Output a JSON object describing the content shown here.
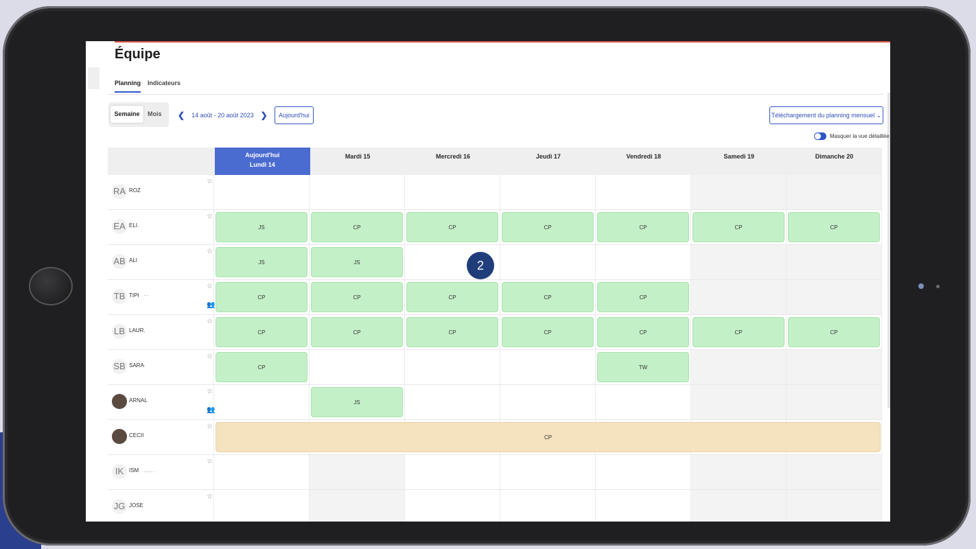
{
  "page": {
    "title": "Équipe",
    "tabs": [
      {
        "label": "Planning"
      },
      {
        "label": "Indicateurs"
      }
    ]
  },
  "toolbar": {
    "view_week": "Semaine",
    "view_month": "Mois",
    "prev_arrow": "❮",
    "date_range": "14 août - 20 août 2023",
    "next_arrow": "❯",
    "today_button": "Aujourd'hui",
    "download_button": "Téléchargement du planning mensuel ⌄",
    "toggle_label": "Masquer la vue détaillée"
  },
  "header": {
    "today_line1": "Aujourd'hui",
    "today_line2": "Lundi 14",
    "days": [
      "Mardi 15",
      "Mercredi 16",
      "Jeudi 17",
      "Vendredi 18",
      "Samedi 19",
      "Dimanche 20"
    ]
  },
  "rows": [
    {
      "initials": "RA",
      "name": "ROZ",
      "extra": "",
      "photo": false,
      "group": false,
      "cells": [
        "",
        "",
        "",
        "",
        "",
        "",
        ""
      ]
    },
    {
      "initials": "EA",
      "name": "ELI.",
      "extra": "",
      "photo": false,
      "group": false,
      "cells": [
        "JS",
        "CP",
        "CP",
        "CP",
        "CP",
        "CP",
        "CP"
      ]
    },
    {
      "initials": "AB",
      "name": "ALI",
      "extra": "",
      "photo": false,
      "group": false,
      "cells": [
        "JS",
        "JS",
        "",
        "",
        "",
        "",
        ""
      ]
    },
    {
      "initials": "TB",
      "name": "TIPł",
      "extra": "···",
      "photo": false,
      "group": true,
      "cells": [
        "CP",
        "CP",
        "CP",
        "CP",
        "CP",
        "",
        ""
      ]
    },
    {
      "initials": "LB",
      "name": "LAUR.",
      "extra": "",
      "photo": false,
      "group": false,
      "cells": [
        "CP",
        "CP",
        "CP",
        "CP",
        "CP",
        "CP",
        "CP"
      ]
    },
    {
      "initials": "SB",
      "name": "SARA",
      "extra": "·",
      "photo": false,
      "group": false,
      "cells": [
        "CP",
        "",
        "",
        "",
        "TW",
        "",
        ""
      ]
    },
    {
      "initials": "",
      "name": "ARNAL",
      "extra": "",
      "photo": true,
      "group": true,
      "cells": [
        "",
        "JS",
        "",
        "",
        "",
        "",
        ""
      ]
    },
    {
      "initials": "",
      "name": "CECII",
      "extra": "",
      "photo": true,
      "group": false,
      "wide": "CP",
      "cells": []
    },
    {
      "initials": "IK",
      "name": "ISM",
      "extra": "...... .",
      "photo": false,
      "group": false,
      "cells": [
        "",
        "",
        "",
        "",
        "",
        "",
        ""
      ]
    },
    {
      "initials": "JG",
      "name": "JOSE",
      "extra": "",
      "photo": false,
      "group": false,
      "cells": [
        "",
        "",
        "",
        "",
        "",
        "",
        ""
      ]
    }
  ],
  "weekend_pattern": [
    [
      false,
      false,
      false,
      false,
      false,
      true,
      true
    ],
    [
      false,
      false,
      false,
      false,
      false,
      false,
      false
    ],
    [
      false,
      false,
      false,
      false,
      false,
      true,
      true
    ],
    [
      false,
      false,
      false,
      false,
      false,
      true,
      true
    ],
    [
      false,
      false,
      false,
      false,
      false,
      false,
      false
    ],
    [
      false,
      false,
      false,
      false,
      false,
      true,
      true
    ],
    [
      false,
      false,
      false,
      false,
      false,
      true,
      true
    ],
    [
      false,
      false,
      false,
      false,
      false,
      false,
      false
    ],
    [
      false,
      true,
      false,
      false,
      false,
      true,
      true
    ],
    [
      false,
      true,
      false,
      false,
      false,
      true,
      true
    ]
  ],
  "step_badge": "2",
  "colors": {
    "accent": "#2e56c9",
    "today_header": "#4a6bd0",
    "leave_green": "#c4f0c7",
    "leave_beige": "#f5e2bf",
    "badge": "#1f3d7a"
  }
}
